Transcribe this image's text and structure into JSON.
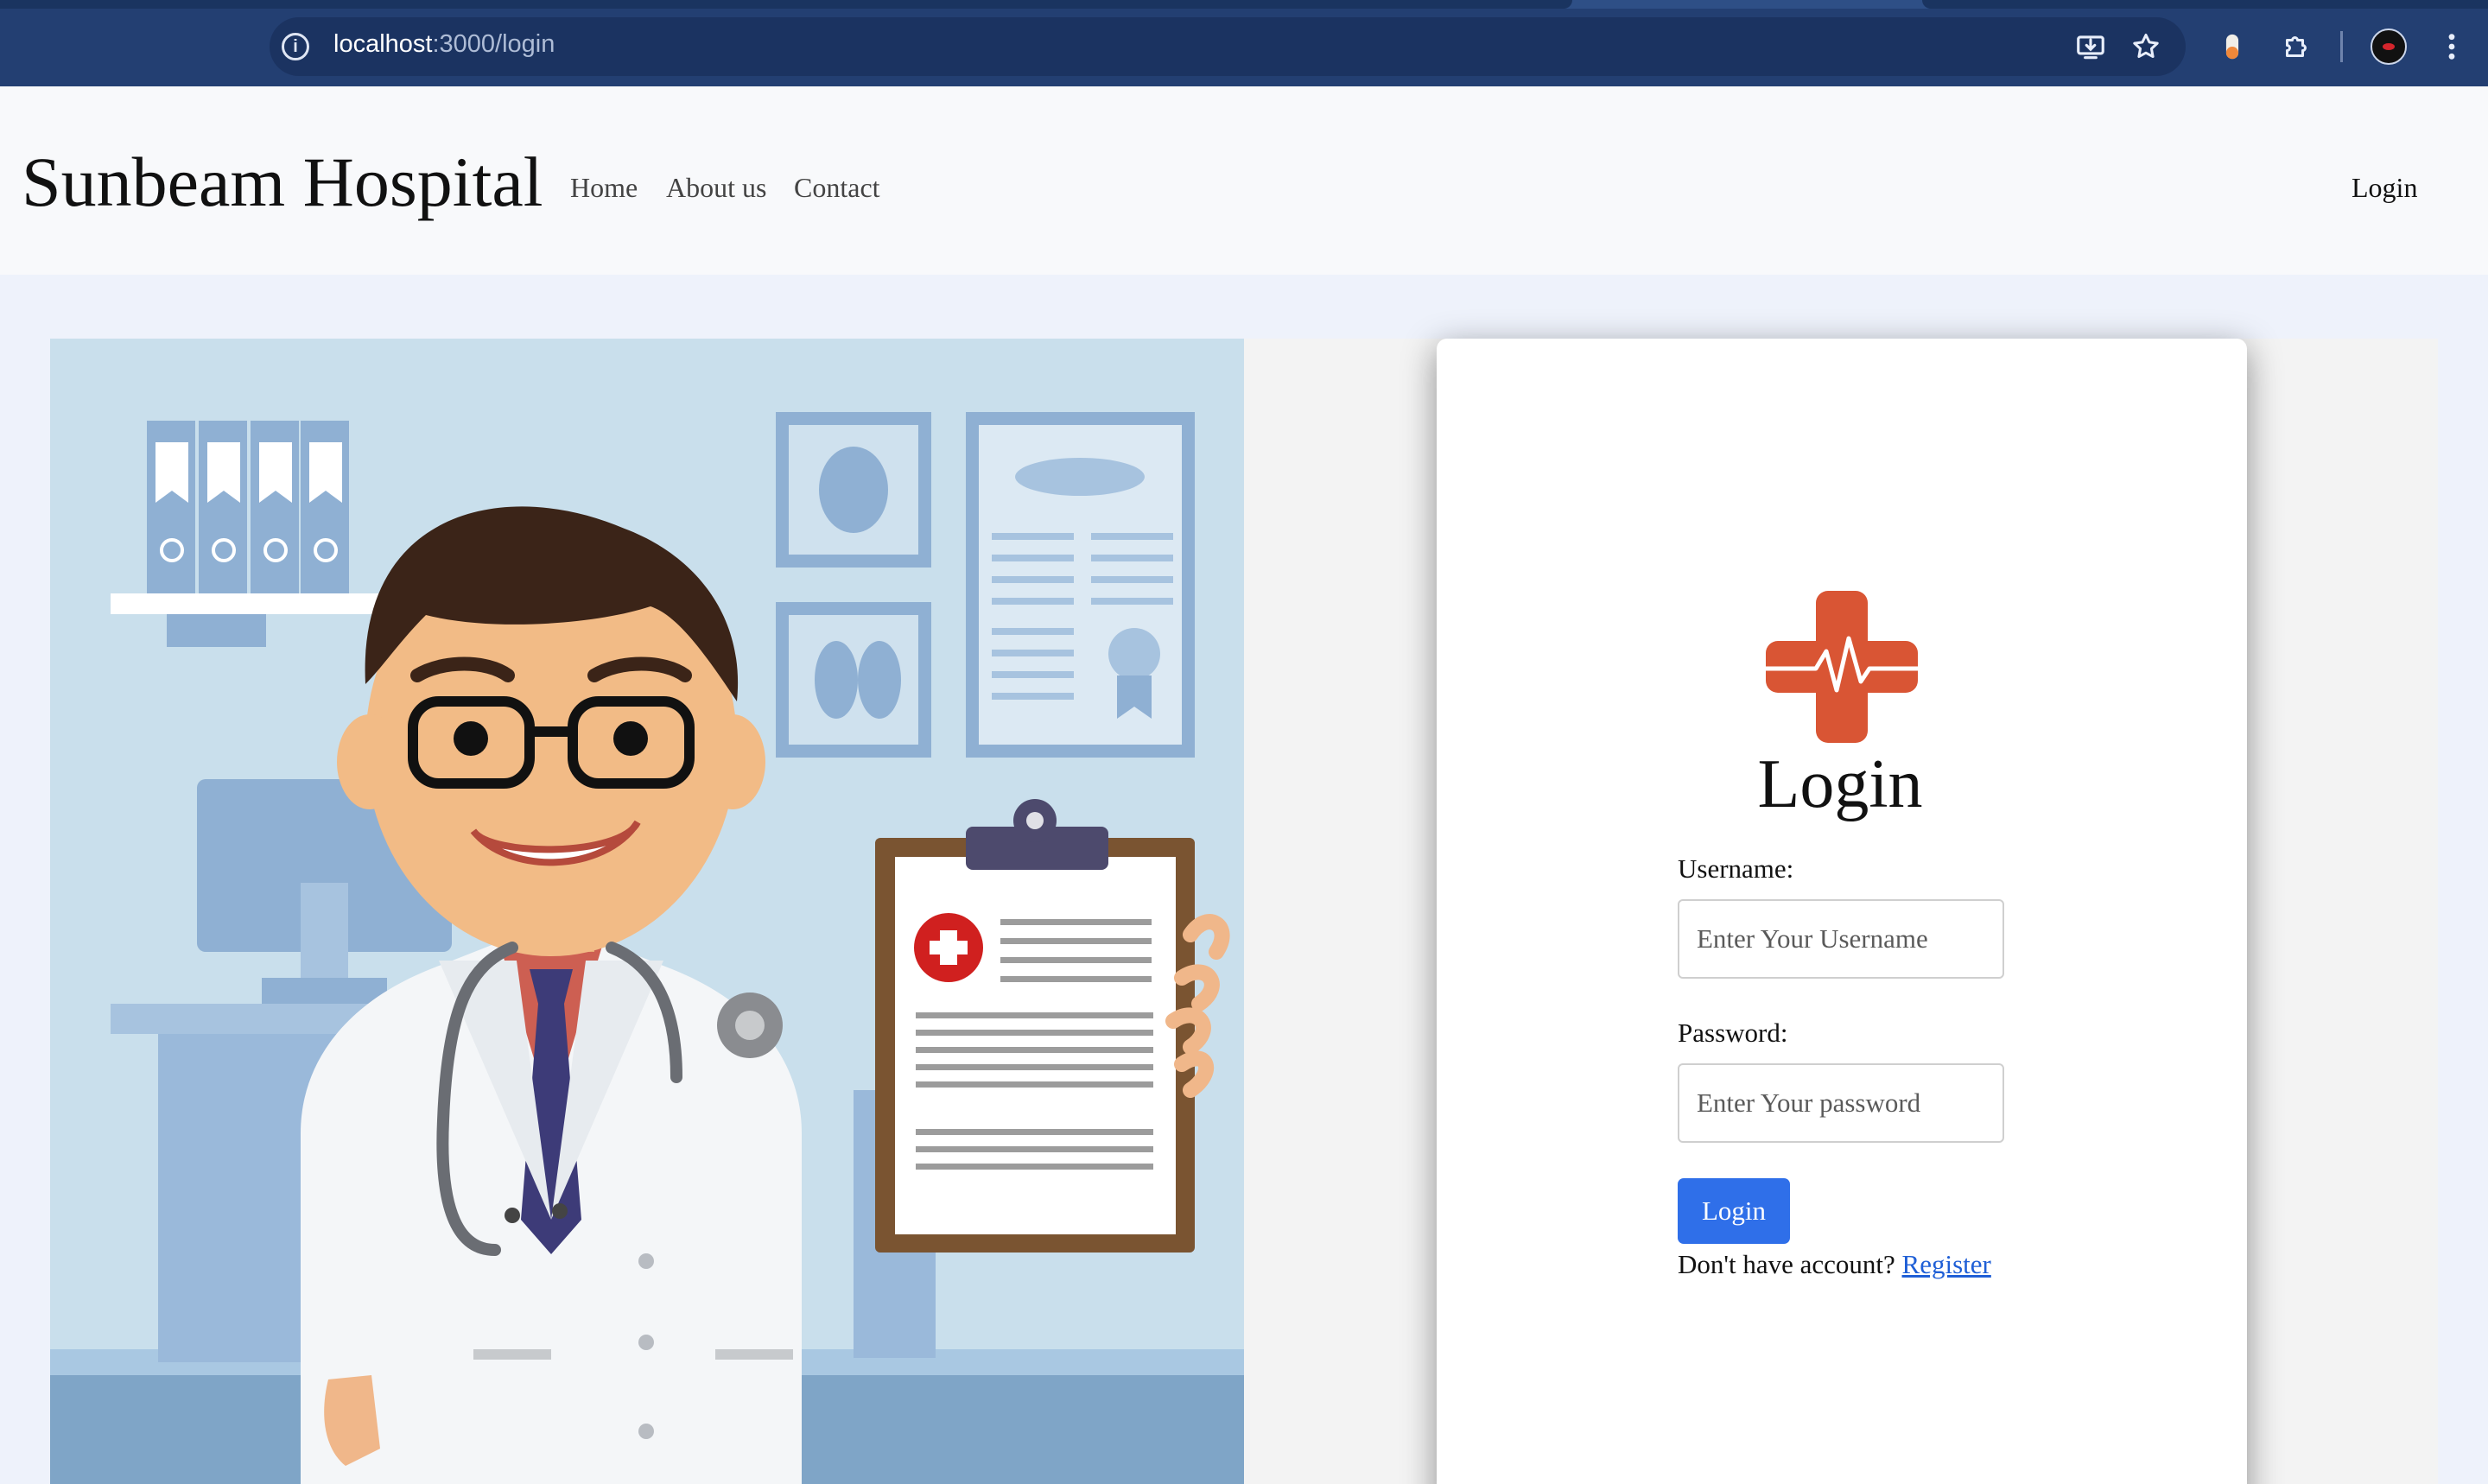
{
  "browser": {
    "url_host": "localhost",
    "url_rest": ":3000/login"
  },
  "navbar": {
    "brand": "Sunbeam Hospital",
    "links": [
      {
        "label": "Home"
      },
      {
        "label": "About us"
      },
      {
        "label": "Contact"
      }
    ],
    "login_label": "Login"
  },
  "login_form": {
    "title": "Login",
    "username_label": "Username:",
    "username_placeholder": "Enter Your Username",
    "password_label": "Password:",
    "password_placeholder": "Enter Your password",
    "submit_label": "Login",
    "register_prompt": "Don't have account?",
    "register_link": "Register"
  },
  "colors": {
    "chrome": "#233f72",
    "accent": "#2f6fe9",
    "logo": "#d95534",
    "link": "#1f5fd6"
  }
}
